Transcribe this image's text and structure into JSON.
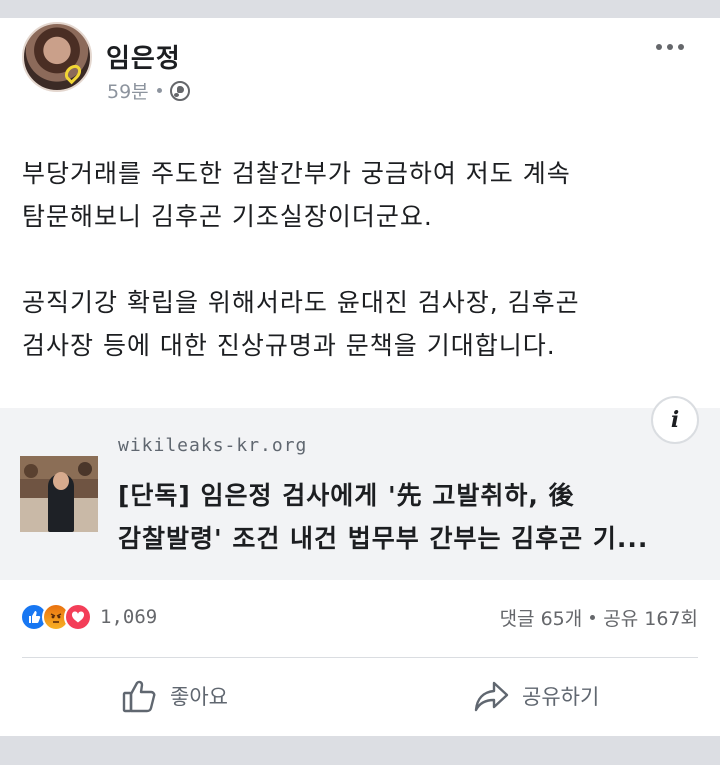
{
  "post": {
    "author": "임은정",
    "time": "59분",
    "paragraphs": [
      [
        "부당거래를 주도한 검찰간부가 궁금하여 저도 계속",
        "탐문해보니 김후곤 기조실장이더군요."
      ],
      [
        "공직기강 확립을 위해서라도 윤대진 검사장, 김후곤",
        "검사장 등에 대한 진상규명과 문책을 기대합니다."
      ]
    ]
  },
  "link_preview": {
    "domain": "wikileaks-kr.org",
    "headline_line1": "[단독] 임은정 검사에게 '先 고발취하, 後",
    "headline_line2": "감찰발령' 조건 내건 법무부 간부는 김후곤 기...",
    "info_label": "i"
  },
  "engagement": {
    "reaction_count": "1,069",
    "comments": "댓글 65개",
    "shares": "공유 167회",
    "reaction_icons": [
      "like-icon",
      "angry-icon",
      "love-icon"
    ]
  },
  "actions": {
    "like_label": "좋아요",
    "share_label": "공유하기"
  },
  "colors": {
    "background": "#e9ebee",
    "card": "#ffffff",
    "preview_bg": "#f2f3f5",
    "like_blue": "#1877f2",
    "love_red": "#f33e58",
    "angry_orange": "#e9710f",
    "muted_text": "#65676b"
  }
}
